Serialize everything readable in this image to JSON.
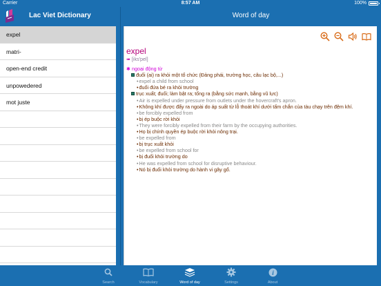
{
  "status": {
    "carrier": "Carrier",
    "time": "8:57 AM",
    "battery": "100%"
  },
  "left_nav": {
    "title": "Lac Viet Dictionary"
  },
  "right_nav": {
    "title": "Word of day"
  },
  "word_list": [
    "expel",
    "matri-",
    "open-end credit",
    "unpowedered",
    "mot juste"
  ],
  "selected_index": 0,
  "entry": {
    "headword": "expel",
    "phonetic": "[iks'pel]",
    "pos": "ngoại động từ",
    "senses": [
      {
        "definition": "đuổi (ai) ra khỏi một tổ chức (Đảng phái, trường học, câu lạc bộ,...)",
        "examples": [
          {
            "en": "expel a child from school",
            "vi": "đuổi đứa bé ra khỏi trường"
          }
        ]
      },
      {
        "definition": "trục xuất; đuổi; làm bật ra; tống ra (bằng sức mạnh, bằng vũ lực)",
        "examples": [
          {
            "en": "Air is expelled under pressure from outlets under the hovercraft's apron.",
            "vi": "Không khí được đẩy ra ngoài do áp suất từ lỗ thoát khí dưới tấm chắn của tàu chạy trên đệm khí."
          },
          {
            "en": "be forcibly expelled from",
            "vi": "bị ép buộc rời khỏi"
          },
          {
            "en": "They were forcibly expelled from their farm by the occupying authorities.",
            "vi": "Họ bị chính quyền ép buộc rời khỏi nông trại."
          },
          {
            "en": "be expelled from",
            "vi": "bị trục xuất khỏi"
          },
          {
            "en": "be expelled from school for",
            "vi": "bị đuổi khỏi trường do"
          },
          {
            "en": "He was expelled from school for disruptive behaviour.",
            "vi": "Nó bị đuổi khỏi trường do hành vi gây gổ."
          }
        ]
      }
    ]
  },
  "tabs": [
    {
      "label": "Search",
      "icon": "search-icon"
    },
    {
      "label": "Vocabulary",
      "icon": "book-icon"
    },
    {
      "label": "Word of day",
      "icon": "stack-icon"
    },
    {
      "label": "Settings",
      "icon": "gear-icon"
    },
    {
      "label": "About",
      "icon": "info-icon"
    }
  ],
  "active_tab": 2,
  "colors": {
    "bar": "#1b6fb1",
    "headword": "#b5007a",
    "tool": "#d86a16"
  }
}
